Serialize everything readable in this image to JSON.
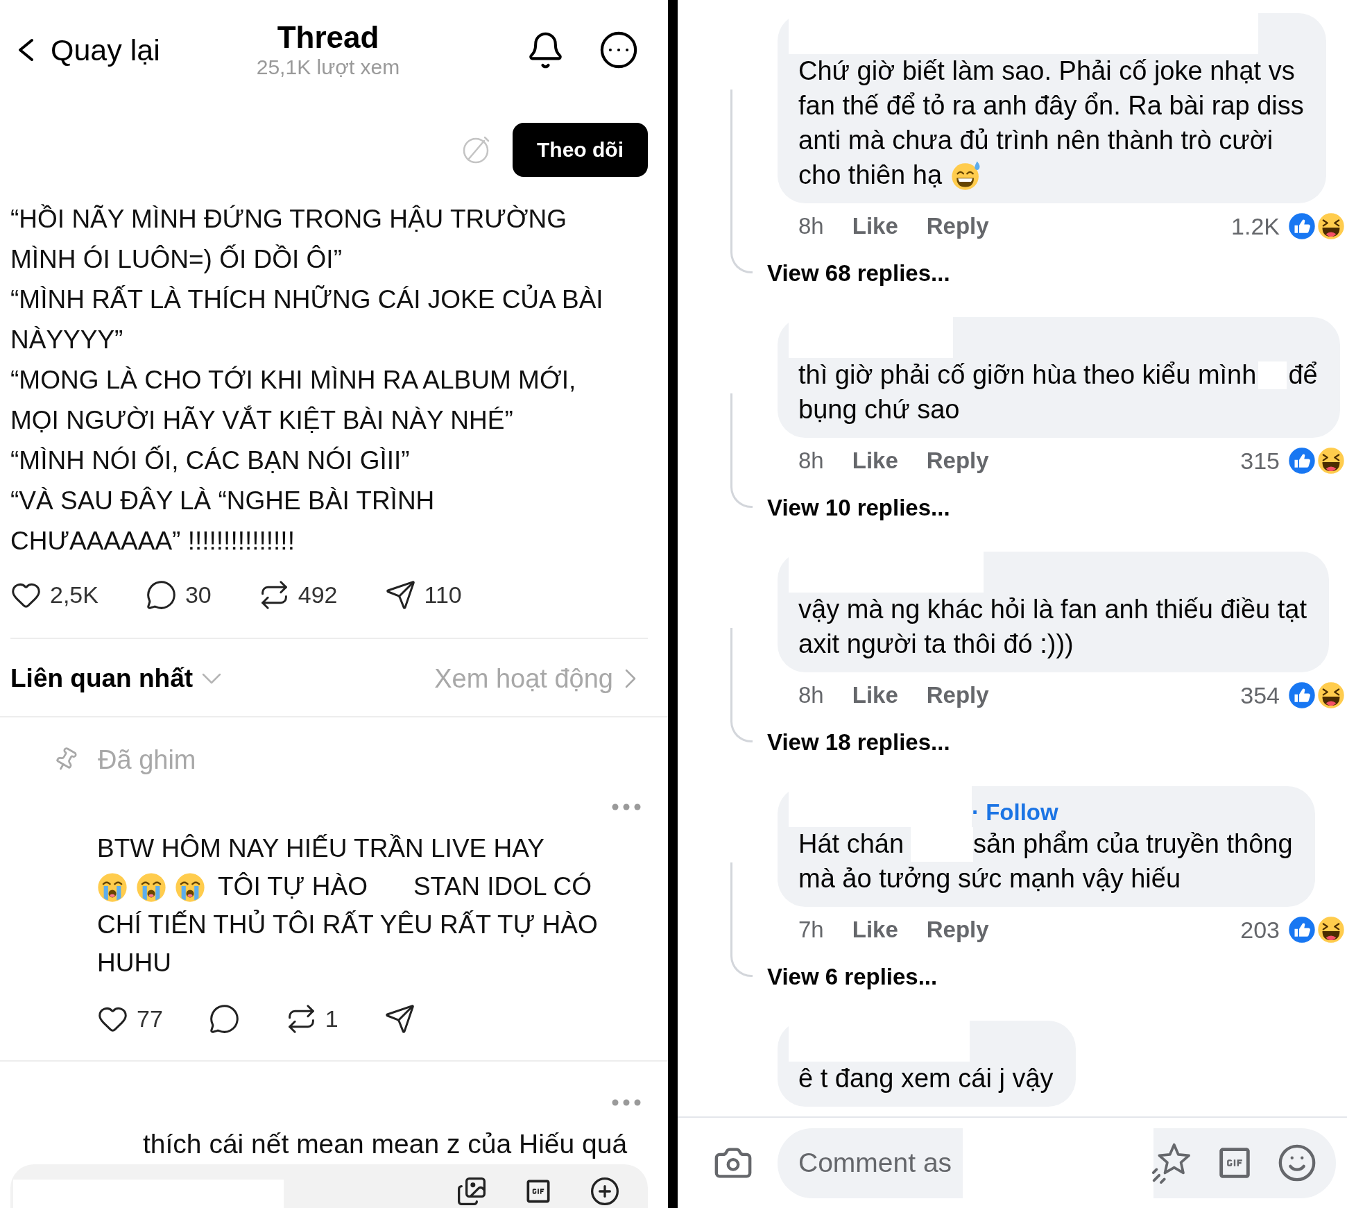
{
  "left": {
    "header": {
      "back": "Quay lại",
      "title": "Thread",
      "views": "25,1K lượt xem"
    },
    "follow_button": "Theo dõi",
    "post": {
      "paragraphs": [
        "“HỒI NÃY MÌNH ĐỨNG TRONG HẬU TRƯỜNG\nMÌNH ÓI LUÔN=) ỐI DỒI ÔI”",
        "“MÌNH RẤT LÀ THÍCH NHỮNG CÁI JOKE CỦA BÀI\nNÀYYYY”",
        "“MONG LÀ CHO TỚI KHI MÌNH RA ALBUM MỚI,\nMỌI NGƯỜI HÃY VẮT KIỆT BÀI NÀY NHÉ”",
        "“MÌNH NÓI ỐI, CÁC BẠN NÓI GÌII”",
        "“VÀ SAU ĐÂY LÀ “NGHE BÀI TRÌNH\nCHƯAAAAAA” !!!!!!!!!!!!!!!"
      ],
      "actions": [
        {
          "kind": "like",
          "count": "2,5K"
        },
        {
          "kind": "comment",
          "count": "30"
        },
        {
          "kind": "repost",
          "count": "492"
        },
        {
          "kind": "share",
          "count": "110"
        }
      ]
    },
    "sort": {
      "label": "Liên quan nhất",
      "activity": "Xem hoạt động"
    },
    "replies": [
      {
        "pinned_label": "Đã ghim",
        "lines": [
          [
            {
              "kind": "text",
              "text": "BTW HÔM NAY HIẾU TRẦN LIVE HAY"
            }
          ],
          [
            {
              "kind": "sob"
            },
            {
              "kind": "sob"
            },
            {
              "kind": "sob"
            },
            {
              "kind": "text",
              "text": "TÔI TỰ HÀO"
            },
            {
              "kind": "redacted"
            },
            {
              "kind": "text",
              "text": "STAN IDOL CÓ"
            }
          ],
          [
            {
              "kind": "text",
              "text": "CHÍ TIẾN THỦ TÔI RẤT YÊU RẤT TỰ HÀO"
            }
          ],
          [
            {
              "kind": "text",
              "text": "HUHU"
            }
          ]
        ],
        "actions": [
          {
            "kind": "like",
            "count": "77"
          },
          {
            "kind": "comment"
          },
          {
            "kind": "repost",
            "count": "1"
          },
          {
            "kind": "share"
          }
        ]
      },
      {
        "lines": [
          [
            {
              "kind": "redacted"
            },
            {
              "kind": "text",
              "text": "thích cái nết mean mean z của Hiếu quá"
            }
          ]
        ]
      }
    ],
    "composer": {
      "redacted_name": true
    }
  },
  "right": {
    "comments": [
      {
        "redacted_name": true,
        "lines": [
          [
            {
              "kind": "text",
              "text": "Chứ giờ biết làm sao. Phải cố joke nhạt vs"
            }
          ],
          [
            {
              "kind": "text",
              "text": "fan thế để tỏ ra anh đây ổn. Ra bài rap diss"
            }
          ],
          [
            {
              "kind": "text",
              "text": "anti mà chưa đủ trình nên thành trò cười"
            }
          ],
          [
            {
              "kind": "text",
              "text": "cho thiên hạ"
            },
            {
              "kind": "sweat"
            }
          ]
        ],
        "time": "8h",
        "like": "Like",
        "reply": "Reply",
        "reactions": "1.2K",
        "view_replies": "View 68 replies..."
      },
      {
        "redacted_name": true,
        "lines": [
          [
            {
              "kind": "text",
              "text": "thì giờ phải cố giỡn hùa theo kiểu mình"
            },
            {
              "kind": "redacted"
            },
            {
              "kind": "text",
              "text": "để"
            }
          ],
          [
            {
              "kind": "text",
              "text": "bụng chứ sao"
            }
          ]
        ],
        "time": "8h",
        "like": "Like",
        "reply": "Reply",
        "reactions": "315",
        "view_replies": "View 10 replies..."
      },
      {
        "redacted_name": true,
        "lines": [
          [
            {
              "kind": "text",
              "text": "vậy mà ng khác hỏi là fan anh thiếu điều tạt"
            }
          ],
          [
            {
              "kind": "text",
              "text": "axit người ta thôi đó :)))"
            }
          ]
        ],
        "time": "8h",
        "like": "Like",
        "reply": "Reply",
        "reactions": "354",
        "view_replies": "View 18 replies..."
      },
      {
        "redacted_name": true,
        "follow": "· Follow",
        "lines": [
          [
            {
              "kind": "text",
              "text": "Hát chán"
            },
            {
              "kind": "redacted"
            },
            {
              "kind": "text",
              "text": "sản phẩm của truyền thông"
            }
          ],
          [
            {
              "kind": "text",
              "text": "mà ảo tưởng sức mạnh vậy hiếu"
            }
          ]
        ],
        "time": "7h",
        "like": "Like",
        "reply": "Reply",
        "reactions": "203",
        "view_replies": "View 6 replies..."
      },
      {
        "redacted_name": true,
        "lines": [
          [
            {
              "kind": "text",
              "text": "ê t đang xem cái j vậy"
            }
          ]
        ]
      }
    ],
    "composer": {
      "placeholder": "Comment as",
      "redacted_name": true
    }
  }
}
